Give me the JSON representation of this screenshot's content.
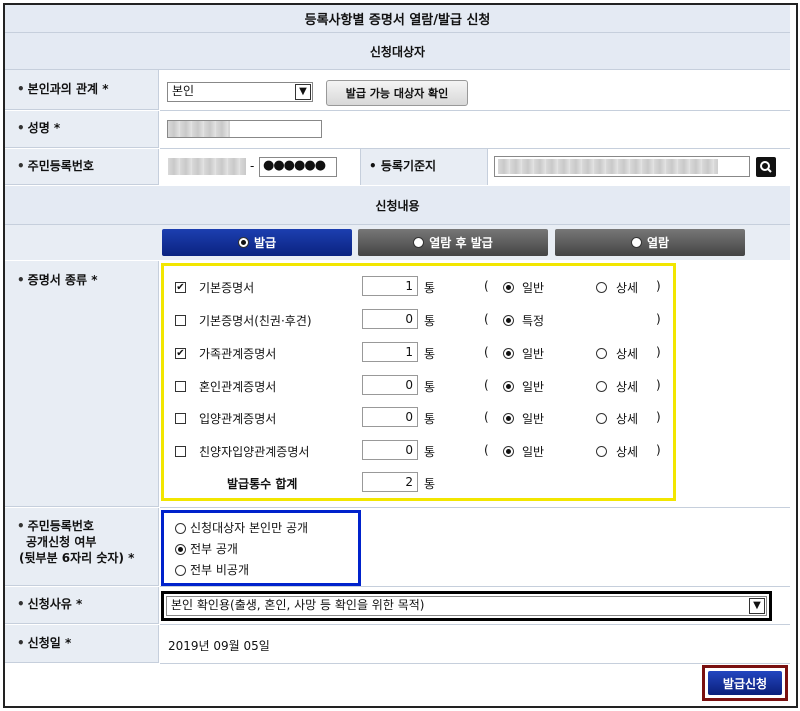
{
  "page_title": "등록사항별 증명서 열람/발급 신청",
  "section_applicant": "신청대상자",
  "section_content": "신청내용",
  "relation": {
    "label": "본인과의 관계 *",
    "selected": "본인",
    "check_button": "발급 가능 대상자 확인"
  },
  "name": {
    "label": "성명 *"
  },
  "rrn": {
    "label": "주민등록번호",
    "dash": "-",
    "masked": "●●●●●●"
  },
  "registry": {
    "label": "등록기준지",
    "search_icon": "search-icon"
  },
  "tabs": [
    {
      "label": "발급",
      "active": true
    },
    {
      "label": "열람 후 발급",
      "active": false
    },
    {
      "label": "열람",
      "active": false
    }
  ],
  "certificate": {
    "label": "증명서 종류 *",
    "unit": "통",
    "open_paren": "(",
    "close_paren": ")",
    "items": [
      {
        "name": "기본증명서",
        "checked": true,
        "count": "1",
        "opt1": "일반",
        "opt2": "상세"
      },
      {
        "name": "기본증명서(친권·후견)",
        "checked": false,
        "count": "0",
        "opt1": "특정",
        "opt2": ""
      },
      {
        "name": "가족관계증명서",
        "checked": true,
        "count": "1",
        "opt1": "일반",
        "opt2": "상세"
      },
      {
        "name": "혼인관계증명서",
        "checked": false,
        "count": "0",
        "opt1": "일반",
        "opt2": "상세"
      },
      {
        "name": "입양관계증명서",
        "checked": false,
        "count": "0",
        "opt1": "일반",
        "opt2": "상세"
      },
      {
        "name": "친양자입양관계증명서",
        "checked": false,
        "count": "0",
        "opt1": "일반",
        "opt2": "상세"
      }
    ],
    "total_label": "발급통수 합계",
    "total_count": "2"
  },
  "disclosure": {
    "label_line1": "주민등록번호",
    "label_line2": "공개신청 여부",
    "label_line3": "(뒷부분 6자리 숫자) *",
    "options": [
      "신청대상자 본인만 공개",
      "전부 공개",
      "전부 비공개"
    ],
    "selected_index": 1
  },
  "reason": {
    "label": "신청사유 *",
    "selected": "본인 확인용(출생, 혼인, 사망 등 확인을 위한 목적)"
  },
  "date": {
    "label": "신청일 *",
    "value": "2019년 09월 05일"
  },
  "submit_button": "발급신청",
  "colors": {
    "highlight_yellow": "#f2e600",
    "highlight_blue": "#0022cc",
    "highlight_black": "#000000",
    "highlight_red": "#7a1010",
    "tab_active": "#0a2a8c",
    "tab_inactive": "#555555"
  }
}
